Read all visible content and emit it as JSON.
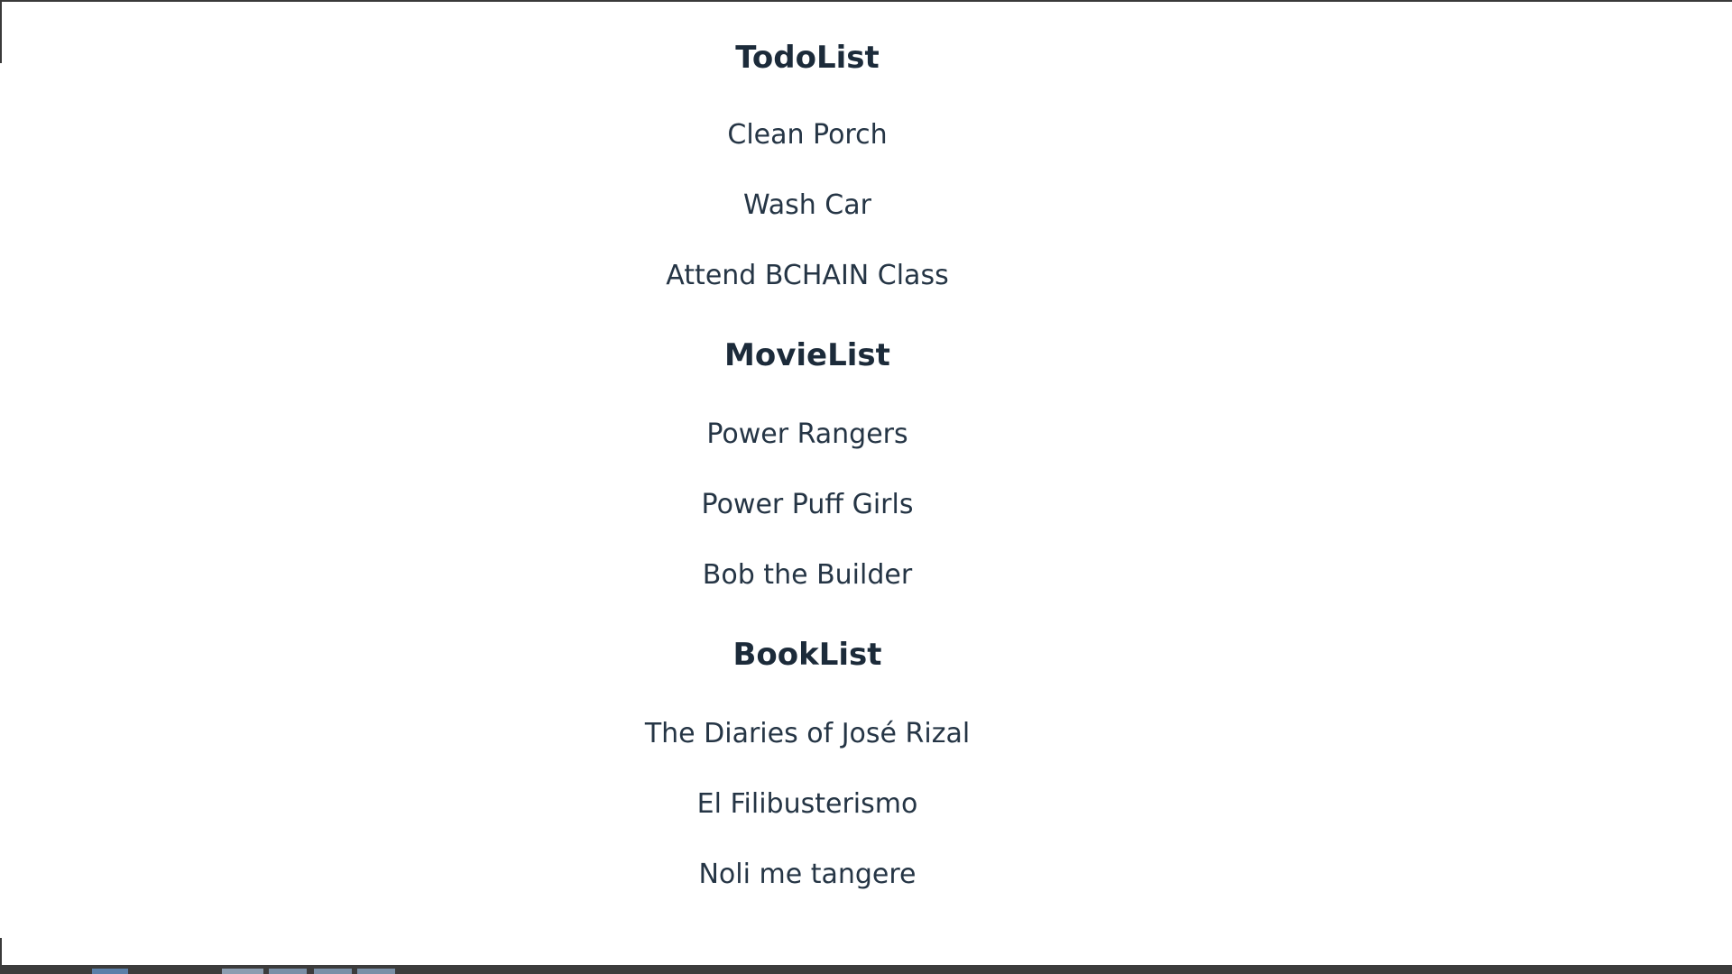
{
  "lists": {
    "todo": {
      "heading": "TodoList",
      "items": [
        "Clean Porch",
        "Wash Car",
        "Attend BCHAIN Class"
      ]
    },
    "movie": {
      "heading": "MovieList",
      "items": [
        "Power Rangers",
        "Power Puff Girls",
        "Bob the Builder"
      ]
    },
    "book": {
      "heading": "BookList",
      "items": [
        "The Diaries of José Rizal",
        "El Filibusterismo",
        "Noli me tangere"
      ]
    }
  },
  "colors": {
    "heading": "#1c2b3a",
    "item": "#253545",
    "taskbar": "#3c3c3c"
  }
}
